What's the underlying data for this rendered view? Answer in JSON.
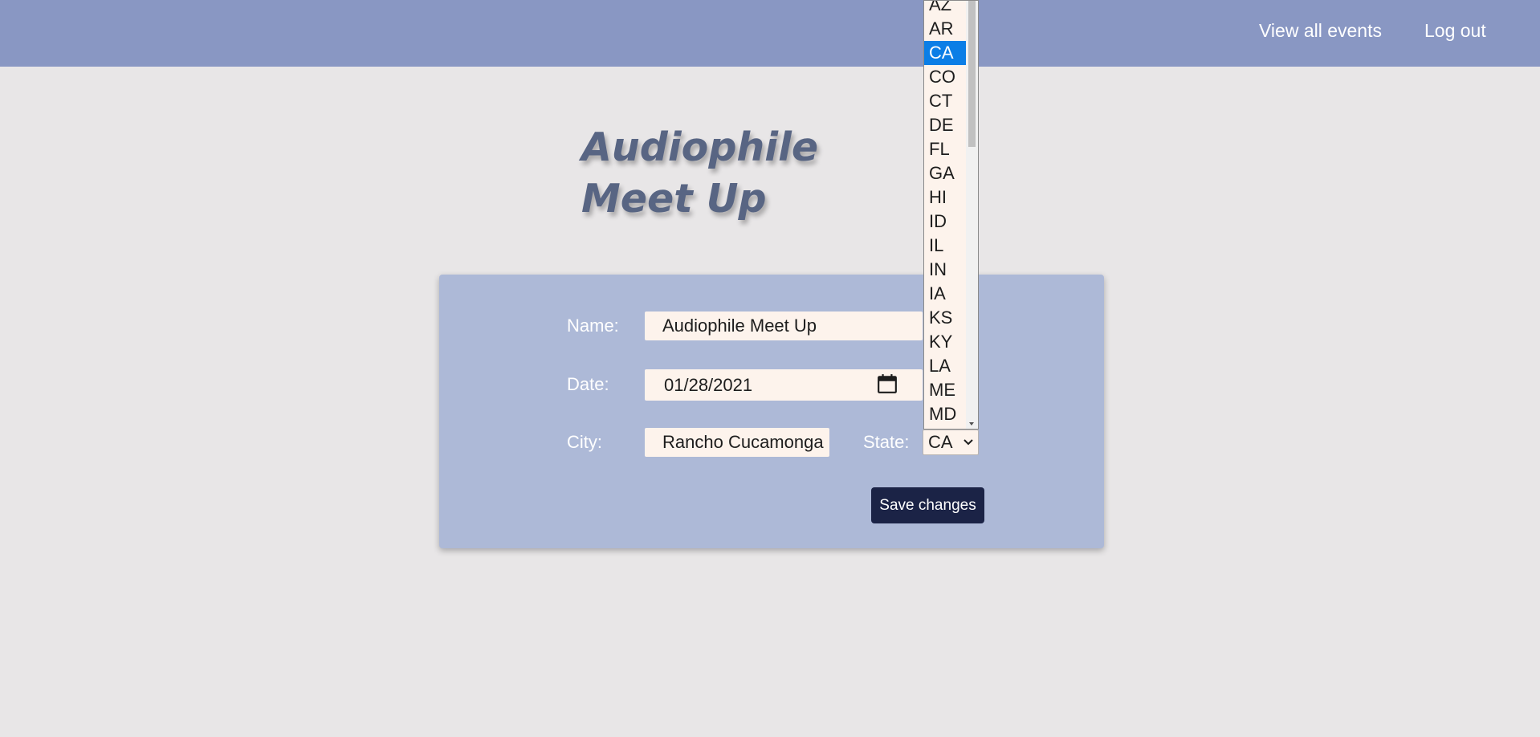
{
  "nav": {
    "view_all_events": "View all events",
    "log_out": "Log out"
  },
  "event": {
    "title": "Audiophile Meet Up"
  },
  "form": {
    "name_label": "Name:",
    "name_value": "Audiophile Meet Up",
    "date_label": "Date:",
    "date_value": "01/28/2021",
    "city_label": "City:",
    "city_value": "Rancho Cucamonga",
    "state_label": "State:",
    "state_value": "CA",
    "save_label": "Save changes"
  },
  "state_dropdown": {
    "options": [
      "AZ",
      "AR",
      "CA",
      "CO",
      "CT",
      "DE",
      "FL",
      "GA",
      "HI",
      "ID",
      "IL",
      "IN",
      "IA",
      "KS",
      "KY",
      "LA",
      "ME",
      "MD"
    ],
    "selected": "CA"
  },
  "colors": {
    "topbar": "#8997c3",
    "card": "#adb9d7",
    "button": "#1b2346",
    "highlight": "#0b7ee6",
    "title": "#586583"
  },
  "icons": {
    "date": "calendar-icon",
    "select": "chevron-down-icon"
  }
}
